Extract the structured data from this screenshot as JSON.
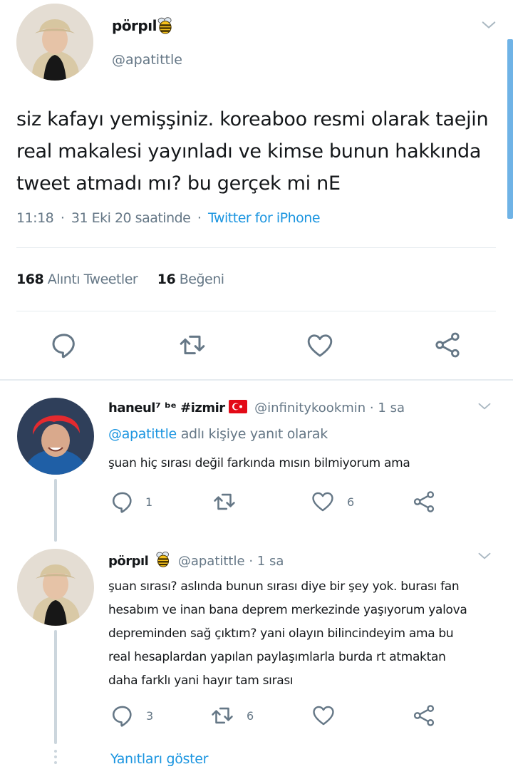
{
  "main_tweet": {
    "display_name": "pörpıl",
    "handle": "@apatittle",
    "text_lines": [
      "siz kafayı yemişşiniz. koreaboo resmi olarak taejin",
      "real makalesi yayınladı ve kimse bunun hakkında",
      "tweet atmadı mı? bu gerçek mi nE"
    ],
    "time": "11:18",
    "date": "31 Eki 20 saatinde",
    "source": "Twitter for iPhone",
    "dot": "·",
    "stats": {
      "quote_count": "168",
      "quote_label": "Alıntı Tweetler",
      "like_count": "16",
      "like_label": "Beğeni"
    }
  },
  "reply1": {
    "display_name": "haneul⁷ ᵇᵉ #izmir",
    "handle": "@infinitykookmin",
    "dot": "·",
    "time": "1 sa",
    "reply_to_handle": "@apatittle",
    "reply_to_suffix": "adlı kişiye yanıt olarak",
    "text": "şuan hiç sırası değil farkında mısın bilmiyorum ama",
    "reply_count": "1",
    "like_count": "6"
  },
  "reply2": {
    "display_name": "pörpıl",
    "handle": "@apatittle",
    "dot": "·",
    "time": "1 sa",
    "text_lines": [
      "şuan sırası? aslında bunun sırası diye bir şey yok. burası fan",
      "hesabım ve inan bana deprem merkezinde yaşıyorum yalova",
      "depreminden sağ çıktım? yani olayın bilincindeyim ama bu",
      "real hesaplardan yapılan paylaşımlarla burda rt atmaktan",
      "daha farklı yani hayır tam sırası"
    ],
    "reply_count": "3",
    "retweet_count": "6"
  },
  "show_replies": "Yanıtları göster",
  "icons": {
    "bee": "bee-emoji-icon",
    "flag": "turkey-flag-icon",
    "reply": "reply-icon",
    "retweet": "retweet-icon",
    "like": "heart-icon",
    "share": "share-icon",
    "chevron": "chevron-down-icon"
  },
  "colors": {
    "accent": "#1b95e0",
    "muted": "#657786",
    "divider": "#e6ecf0",
    "thread_line": "#ccd6dd",
    "scrollbar": "#6fb3e6"
  }
}
